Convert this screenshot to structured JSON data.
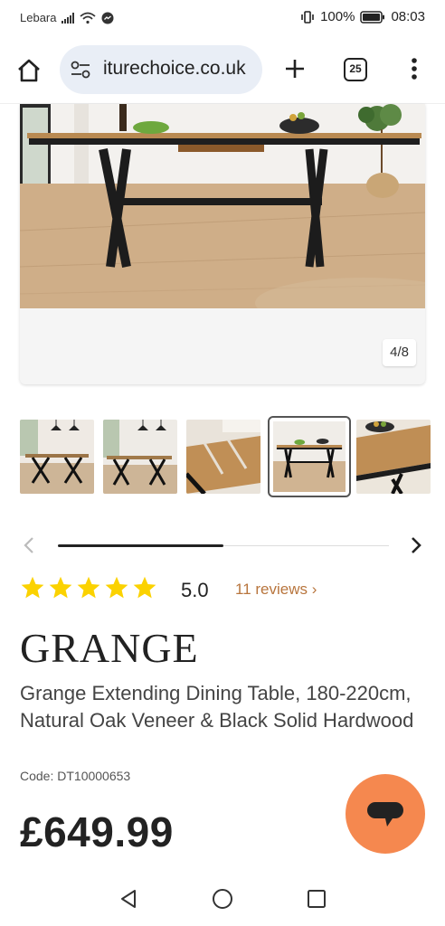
{
  "status_bar": {
    "carrier": "Lebara",
    "battery": "100%",
    "time": "08:03"
  },
  "browser": {
    "url": "iturechoice.co.uk",
    "tab_count": "25"
  },
  "gallery": {
    "page_indicator": "4/8",
    "thumbnail_count": 5,
    "selected_thumbnail": 4
  },
  "carousel": {
    "scroll_position_fraction": 0.5
  },
  "product": {
    "rating": 5,
    "rating_label": "5.0",
    "reviews_link": "11 reviews ›",
    "brand": "GRANGE",
    "name": "Grange Extending Dining Table, 180-220cm, Natural Oak Veneer & Black Solid Hardwood",
    "code": "Code: DT10000653",
    "price": "£649.99"
  },
  "colors": {
    "star": "#fbd200",
    "review_link": "#b8753d",
    "chat_button": "#f5884f",
    "url_pill": "#e9eef6"
  },
  "icons": [
    "home-icon",
    "tune-icon",
    "plus-icon",
    "tabs-icon",
    "more-vert-icon",
    "chevron-left-icon",
    "chevron-right-icon",
    "star-icon",
    "chat-icon",
    "back-icon",
    "home-circle-icon",
    "recents-icon"
  ]
}
